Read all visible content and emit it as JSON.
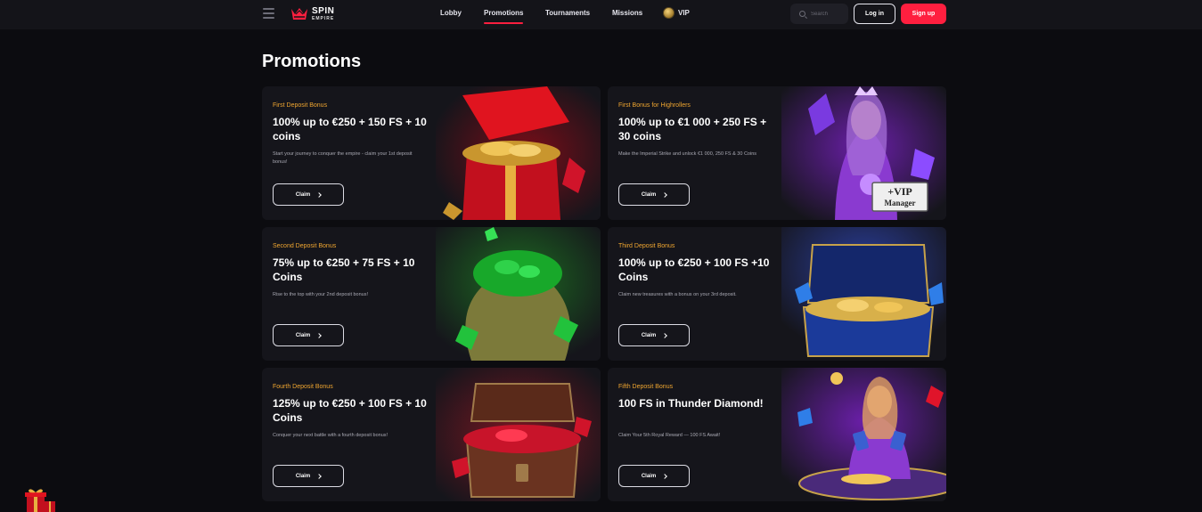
{
  "header": {
    "logo_line1": "SPIN",
    "logo_line2": "EMPIRE",
    "nav": [
      {
        "label": "Lobby"
      },
      {
        "label": "Promotions"
      },
      {
        "label": "Tournaments"
      },
      {
        "label": "Missions"
      },
      {
        "label": "VIP"
      }
    ],
    "search_placeholder": "Search",
    "login_label": "Log in",
    "signup_label": "Sign up"
  },
  "page_title": "Promotions",
  "cards": [
    {
      "kicker": "First Deposit Bonus",
      "title": "100% up to €250 + 150 FS + 10 coins",
      "desc": "Start your journey to conquer the empire - claim your 1st deposit bonus!",
      "claim": "Claim",
      "art": "red-gift-chest-art"
    },
    {
      "kicker": "First Bonus for Highrollers",
      "title": "100% up to €1 000 + 250 FS + 30 coins",
      "desc": "Make the Imperial Strike and unlock €1 000, 250 FS & 30 Coins",
      "claim": "Claim",
      "art": "vip-queen-art",
      "art_text_1": "+VIP",
      "art_text_2": "Manager"
    },
    {
      "kicker": "Second Deposit Bonus",
      "title": "75% up to €250 + 75 FS + 10 Coins",
      "desc": "Rise to the top with your 2nd deposit bonus!",
      "claim": "Claim",
      "art": "emerald-sack-art"
    },
    {
      "kicker": "Third Deposit Bonus",
      "title": "100% up to €250 + 100 FS +10 Coins",
      "desc": "Claim new treasures with a bonus on your 3rd deposit.",
      "claim": "Claim",
      "art": "blue-treasure-chest-art"
    },
    {
      "kicker": "Fourth Deposit Bonus",
      "title": "125% up to €250 + 100 FS + 10 Coins",
      "desc": "Conquer your next battle with a fourth deposit bonus!",
      "claim": "Claim",
      "art": "ruby-treasure-chest-art"
    },
    {
      "kicker": "Fifth Deposit Bonus",
      "title": "100 FS in Thunder Diamond!",
      "desc": "Claim Your 5th Royal Reward — 100 FS Await!",
      "claim": "Claim",
      "art": "card-dealer-art"
    }
  ],
  "colors": {
    "accent": "#ff1f3f",
    "kicker": "#f0a630",
    "background": "#0c0c10",
    "card": "#15151b"
  }
}
